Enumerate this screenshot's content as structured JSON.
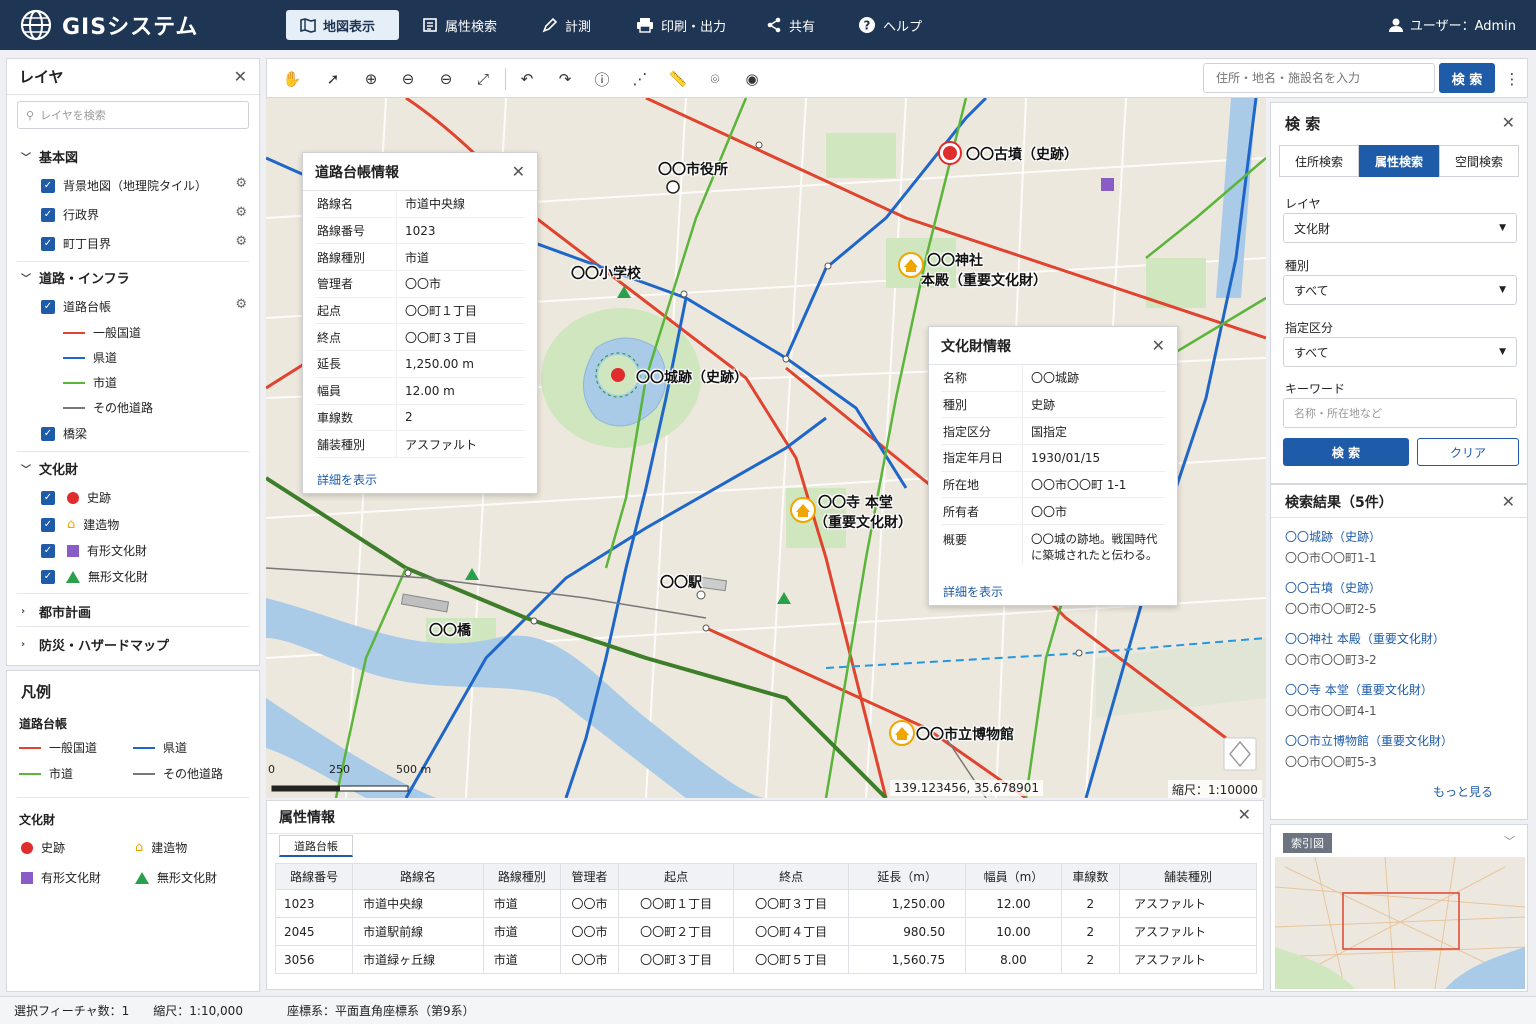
{
  "app": {
    "title": "GISシステム",
    "user": "ユーザー：Admin"
  },
  "nav": [
    {
      "label": "地図表示"
    },
    {
      "label": "属性検索"
    },
    {
      "label": "計測"
    },
    {
      "label": "印刷・出力"
    },
    {
      "label": "共有"
    },
    {
      "label": "ヘルプ"
    }
  ],
  "layers": {
    "title": "レイヤ",
    "search_placeholder": "レイヤを検索",
    "base": {
      "label": "基本図",
      "items": [
        "背景地図（地理院タイル）",
        "行政界",
        "町丁目界"
      ]
    },
    "road": {
      "label": "道路・インフラ",
      "ledger": "道路台帳",
      "sub": [
        "一般国道",
        "県道",
        "市道",
        "その他道路"
      ],
      "bridge": "橋梁"
    },
    "culture": {
      "label": "文化財",
      "items": [
        "史跡",
        "建造物",
        "有形文化財",
        "無形文化財"
      ]
    },
    "urban": "都市計画",
    "disaster": "防災・ハザードマップ"
  },
  "legend": {
    "title": "凡例",
    "road_title": "道路台帳",
    "road": [
      "一般国道",
      "県道",
      "市道",
      "その他道路"
    ],
    "culture_title": "文化財",
    "culture": [
      "史跡",
      "建造物",
      "有形文化財",
      "無形文化財"
    ]
  },
  "colors": {
    "national": "#e0442f",
    "prefectural": "#1e66c8",
    "city": "#5bb53a",
    "other": "#777777",
    "site": "#e02c2c",
    "building": "#f0a500",
    "tangible": "#8a5cc6",
    "intangible": "#2aa04a",
    "primary": "#1e5ba8",
    "header": "#1e3553"
  },
  "search": {
    "placeholder": "住所・地名・施設名を入力",
    "button": "検 索"
  },
  "map": {
    "labels": {
      "cityhall": "〇〇市役所",
      "tomb": "〇〇古墳（史跡）",
      "shrine1": "〇〇神社",
      "shrine2": "本殿（重要文化財）",
      "school": "〇〇小学校",
      "castle": "〇〇城跡（史跡）",
      "temple1": "〇〇寺 本堂",
      "temple2": "（重要文化財）",
      "station": "〇〇駅",
      "bridge": "〇〇橋",
      "museum": "〇〇市立博物館"
    },
    "scale": {
      "t0": "0",
      "t1": "250",
      "t2": "500 m"
    },
    "coords": "139.123456, 35.678901",
    "scale_text": "縮尺：1:10000"
  },
  "road_popup": {
    "title": "道路台帳情報",
    "rows": [
      [
        "路線名",
        "市道中央線"
      ],
      [
        "路線番号",
        "1023"
      ],
      [
        "路線種別",
        "市道"
      ],
      [
        "管理者",
        "〇〇市"
      ],
      [
        "起点",
        "〇〇町１丁目"
      ],
      [
        "終点",
        "〇〇町３丁目"
      ],
      [
        "延長",
        "1,250.00 m"
      ],
      [
        "幅員",
        "12.00 m"
      ],
      [
        "車線数",
        "2"
      ],
      [
        "舗装種別",
        "アスファルト"
      ]
    ],
    "link": "詳細を表示"
  },
  "culture_popup": {
    "title": "文化財情報",
    "rows": [
      [
        "名称",
        "〇〇城跡"
      ],
      [
        "種別",
        "史跡"
      ],
      [
        "指定区分",
        "国指定"
      ],
      [
        "指定年月日",
        "1930/01/15"
      ],
      [
        "所在地",
        "〇〇市〇〇町 1-1"
      ],
      [
        "所有者",
        "〇〇市"
      ]
    ],
    "summary_key": "概要",
    "summary1": "〇〇城の跡地。戦国時代",
    "summary2": "に築城されたと伝わる。",
    "link": "詳細を表示"
  },
  "attr": {
    "title": "属性情報",
    "tab": "道路台帳",
    "headers": [
      "路線番号",
      "路線名",
      "路線種別",
      "管理者",
      "起点",
      "終点",
      "延長（m）",
      "幅員（m）",
      "車線数",
      "舗装種別"
    ],
    "rows": [
      [
        "1023",
        "市道中央線",
        "市道",
        "〇〇市",
        "〇〇町１丁目",
        "〇〇町３丁目",
        "1,250.00",
        "12.00",
        "2",
        "アスファルト"
      ],
      [
        "2045",
        "市道駅前線",
        "市道",
        "〇〇市",
        "〇〇町２丁目",
        "〇〇町４丁目",
        "980.50",
        "10.00",
        "2",
        "アスファルト"
      ],
      [
        "3056",
        "市道緑ヶ丘線",
        "市道",
        "〇〇市",
        "〇〇町３丁目",
        "〇〇町５丁目",
        "1,560.75",
        "8.00",
        "2",
        "アスファルト"
      ]
    ]
  },
  "search_panel": {
    "title": "検 索",
    "tabs": [
      "住所検索",
      "属性検索",
      "空間検索"
    ],
    "layer_label": "レイヤ",
    "layer_value": "文化財",
    "type_label": "種別",
    "type_value": "すべて",
    "designation_label": "指定区分",
    "designation_value": "すべて",
    "keyword_label": "キーワード",
    "keyword_placeholder": "名称・所在地など",
    "search_btn": "検 索",
    "clear_btn": "クリア"
  },
  "results": {
    "title": "検索結果（5件）",
    "items": [
      {
        "name": "〇〇城跡（史跡）",
        "addr": "〇〇市〇〇町1-1"
      },
      {
        "name": "〇〇古墳（史跡）",
        "addr": "〇〇市〇〇町2-5"
      },
      {
        "name": "〇〇神社 本殿（重要文化財）",
        "addr": "〇〇市〇〇町3-2"
      },
      {
        "name": "〇〇寺 本堂（重要文化財）",
        "addr": "〇〇市〇〇町4-1"
      },
      {
        "name": "〇〇市立博物館（重要文化財）",
        "addr": "〇〇市〇〇町5-3"
      }
    ],
    "more": "もっと見る"
  },
  "index_map": {
    "title": "索引図"
  },
  "status": {
    "selected": "選択フィーチャ数：1",
    "scale": "縮尺：1:10,000",
    "crs": "座標系：平面直角座標系（第9系）"
  }
}
